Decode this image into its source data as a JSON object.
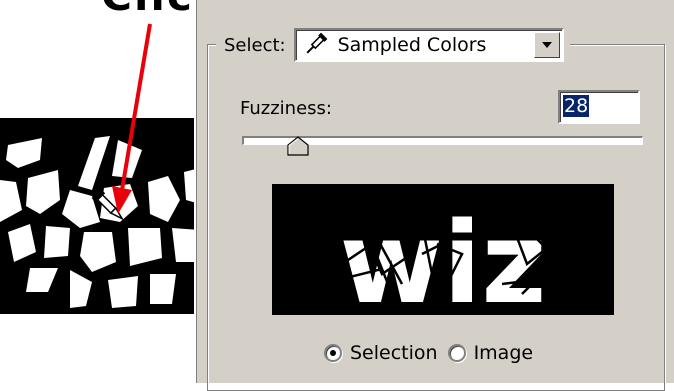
{
  "annotation": {
    "text": "Click"
  },
  "dialog": {
    "select_label": "Select:",
    "select_value": "Sampled Colors",
    "fuzziness_label": "Fuzziness:",
    "fuzziness_value": "28",
    "fuzziness_fraction": 0.14,
    "preview_text": "wiz",
    "radio_options": [
      {
        "label": "Selection",
        "checked": true
      },
      {
        "label": "Image",
        "checked": false
      }
    ]
  },
  "colors": {
    "dialog_bg": "#d4d0c8",
    "arrow": "#e8000b",
    "highlight": "#0a246a"
  },
  "icons": {
    "eyedropper": "eyedropper-icon",
    "dropdown": "chevron-down-icon"
  }
}
